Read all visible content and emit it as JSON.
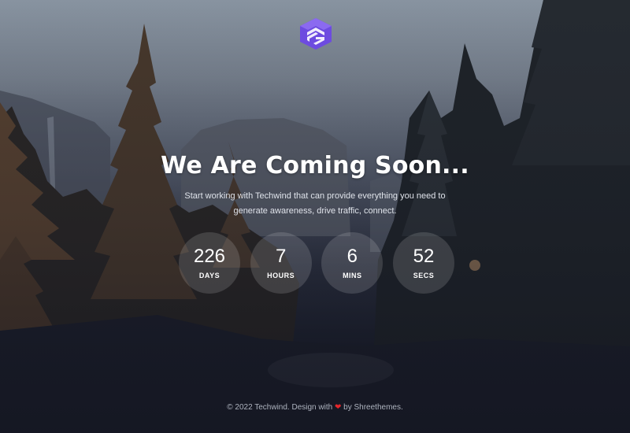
{
  "hero": {
    "title": "We Are Coming Soon...",
    "subtitle": "Start working with Techwind that can provide everything you need to generate awareness, drive traffic, connect."
  },
  "countdown": [
    {
      "value": "226",
      "label": "DAYS"
    },
    {
      "value": "7",
      "label": "HOURS"
    },
    {
      "value": "6",
      "label": "MINS"
    },
    {
      "value": "52",
      "label": "SECS"
    }
  ],
  "footer": {
    "prefix": "© 2022 Techwind. Design with",
    "suffix": "by Shreethemes.",
    "heart_icon": "heart-icon"
  },
  "colors": {
    "logo": "#6d4be0",
    "heart": "#e4262b"
  }
}
